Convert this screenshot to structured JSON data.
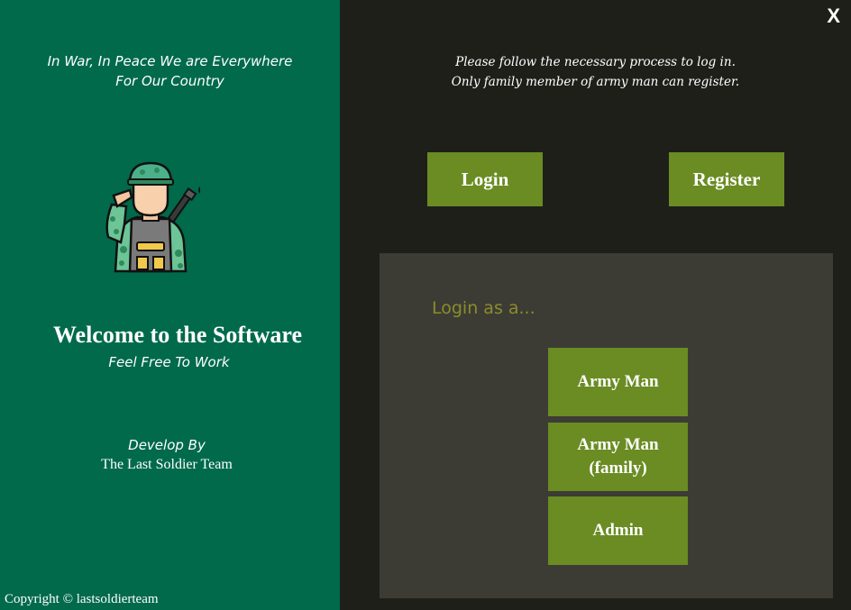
{
  "left": {
    "motto_line1": "In War, In Peace We are Everywhere",
    "motto_line2": "For Our Country",
    "soldier_icon": "saluting-soldier-icon",
    "welcome_title": "Welcome to the Software",
    "welcome_subtitle": "Feel Free To Work",
    "develop_by": "Develop By",
    "team_name": "The Last Soldier Team",
    "copyright": "Copyright © lastsoldierteam"
  },
  "right": {
    "close_label": "X",
    "instruction_line1": "Please follow the necessary process to log in.",
    "instruction_line2": "Only family member of army man can register.",
    "login_label": "Login",
    "register_label": "Register",
    "login_as_heading": "Login as a...",
    "roles": [
      {
        "label": "Army Man"
      },
      {
        "label": "Army Man (family)"
      },
      {
        "label": "Admin"
      }
    ]
  },
  "colors": {
    "left_bg": "#006a4b",
    "right_bg": "#1f1f1a",
    "box_bg": "#3c3c35",
    "button_green": "#6a8c23",
    "heading_olive": "#8c8c2c"
  }
}
